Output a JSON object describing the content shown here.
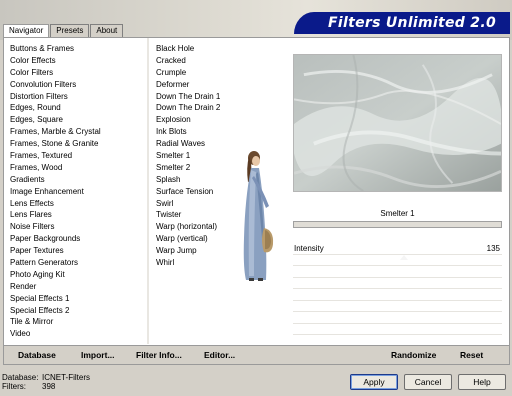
{
  "app": {
    "banner_title": "Filters Unlimited 2.0"
  },
  "tabs": [
    "Navigator",
    "Presets",
    "About"
  ],
  "categories": [
    "Buttons & Frames",
    "Color Effects",
    "Color Filters",
    "Convolution Filters",
    "Distortion Filters",
    "Edges, Round",
    "Edges, Square",
    "Frames, Marble & Crystal",
    "Frames, Stone & Granite",
    "Frames, Textured",
    "Frames, Wood",
    "Gradients",
    "Image Enhancement",
    "Lens Effects",
    "Lens Flares",
    "Noise Filters",
    "Paper Backgrounds",
    "Paper Textures",
    "Pattern Generators",
    "Photo Aging Kit",
    "Render",
    "Special Effects 1",
    "Special Effects 2",
    "Tile & Mirror",
    "Video"
  ],
  "filters": [
    "Black Hole",
    "Cracked",
    "Crumple",
    "Deformer",
    "Down The Drain 1",
    "Down The Drain 2",
    "Explosion",
    "Ink Blots",
    "Radial Waves",
    "Smelter 1",
    "Smelter 2",
    "Splash",
    "Surface Tension",
    "Swirl",
    "Twister",
    "Warp (horizontal)",
    "Warp (vertical)",
    "Warp Jump",
    "Whirl"
  ],
  "preview": {
    "filter_name": "Smelter 1",
    "progress": 0
  },
  "params": [
    {
      "label": "Intensity",
      "value": "135"
    }
  ],
  "bottom_left": {
    "database": "Database",
    "import": "Import...",
    "filter_info": "Filter Info...",
    "editor": "Editor..."
  },
  "bottom_right": {
    "randomize": "Randomize",
    "reset": "Reset"
  },
  "status": {
    "database_label": "Database:",
    "database_value": "ICNET-Filters",
    "filters_label": "Filters:",
    "filters_value": "398"
  },
  "dialog": {
    "apply": "Apply",
    "cancel": "Cancel",
    "help": "Help"
  }
}
